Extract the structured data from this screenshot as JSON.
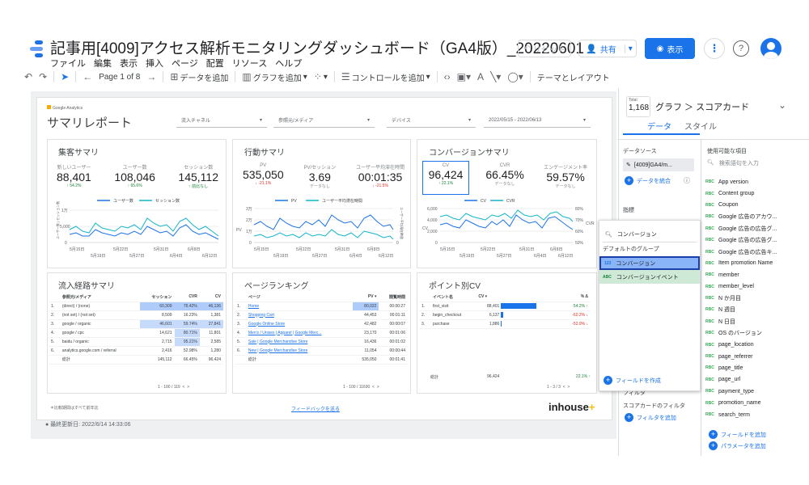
{
  "app": {
    "title": "記事用[4009]アクセス解析モニタリングダッシュボード（GA4版）_20220601",
    "menu": [
      "ファイル",
      "編集",
      "表示",
      "挿入",
      "ページ",
      "配置",
      "リソース",
      "ヘルプ"
    ],
    "reset_label": "リセット",
    "share_label": "共有",
    "view_label": "表示"
  },
  "toolbar": {
    "page_label": "Page 1 of 8",
    "add_data": "データを追加",
    "add_chart": "グラフを追加",
    "add_control": "コントロールを追加",
    "theme_layout": "テーマとレイアウト"
  },
  "report": {
    "ga_label": "Google Analytics",
    "title": "サマリレポート",
    "filters": [
      "流入チャネル",
      "参照元/メディア",
      "デバイス"
    ],
    "date_range": "2022/05/15 - 2022/06/13",
    "footnote": "＊比較期間はすべて前年比",
    "feedback": "フィードバックを送る",
    "brand_a": "inhouse",
    "brand_b": "+",
    "last_updated": "最終更新日: 2022/6/14 14:33:06"
  },
  "acquisition": {
    "title": "集客サマリ",
    "kpis": [
      {
        "label": "新しいユーザー",
        "value": "88,401",
        "delta": "↑ 54.2%"
      },
      {
        "label": "ユーザー数",
        "value": "108,046",
        "delta": "↑ 65.6%"
      },
      {
        "label": "セッション数",
        "value": "145,112",
        "delta": "↑ 前比なし"
      }
    ],
    "legend": [
      "ユーザー数",
      "セッション数"
    ],
    "yticks": [
      "15,000",
      "10,000",
      "5,000",
      "0"
    ],
    "xticks_top": [
      "5月15日",
      "5月22日",
      "5月31日",
      "6月8日"
    ],
    "xticks_bot": [
      "5月19日",
      "5月27日",
      "6月4日",
      "6月12日"
    ],
    "axis_label": "ユーザー数 | セッション数"
  },
  "behavior": {
    "title": "行動サマリ",
    "kpis": [
      {
        "label": "PV",
        "value": "535,050",
        "delta": "↓ -21.1%"
      },
      {
        "label": "PV/セッション",
        "value": "3.69",
        "delta": "データなし"
      },
      {
        "label": "ユーザー平均滞在時間",
        "value": "00:01:35",
        "delta": "↓ -21.5%"
      }
    ],
    "legend": [
      "PV",
      "ユーザー平均滞在時間"
    ],
    "yticks_left": [
      "30,000",
      "20,000",
      "10,000",
      "0"
    ],
    "yticks_right": [
      "200",
      "150",
      "100",
      "50",
      "0"
    ],
    "y_right_label": "ユーザー平均滞在時間",
    "y_left_label": "PV"
  },
  "conversion": {
    "title": "コンバージョンサマリ",
    "kpis": [
      {
        "label": "CV",
        "value": "96,424",
        "delta": "↑ 22.1%"
      },
      {
        "label": "CVR",
        "value": "66.45%",
        "delta": "データなし"
      },
      {
        "label": "エンゲージメント率",
        "value": "59.57%",
        "delta": "データなし"
      }
    ],
    "legend": [
      "CV",
      "CVR"
    ],
    "yticks_left": [
      "6,000",
      "4,000",
      "2,000",
      "0"
    ],
    "yticks_right": [
      "80%",
      "70%",
      "60%",
      "50%"
    ],
    "y_left_label": "CV",
    "y_right_label": "CVR"
  },
  "traffic": {
    "title": "流入経路サマリ",
    "headers": [
      "参照元/メディア",
      "セッション",
      "CVR",
      "CV"
    ],
    "rows": [
      [
        "1.",
        "(direct) / (none)",
        "60,309",
        "76.42%",
        "46,136"
      ],
      [
        "2.",
        "(not set) / (not set)",
        "8,509",
        "16.23%",
        "1,381"
      ],
      [
        "3.",
        "google / organic",
        "46,601",
        "59.74%",
        "27,841"
      ],
      [
        "4.",
        "google / cpc",
        "14,621",
        "80.71%",
        "11,801"
      ],
      [
        "5.",
        "baidu / organic",
        "2,715",
        "95.21%",
        "2,585"
      ],
      [
        "6.",
        "analytics.google.com / referral",
        "2,416",
        "52.98%",
        "1,280"
      ]
    ],
    "total": [
      "総計",
      "145,112",
      "66.45%",
      "96,424"
    ],
    "pager": "1 - 100 / 119"
  },
  "pages": {
    "title": "ページランキング",
    "headers": [
      "ページ",
      "PV ▾",
      "閲覧時間"
    ],
    "rows": [
      [
        "1.",
        "Home",
        "80,022",
        "00:00:27"
      ],
      [
        "2.",
        "Shopping Cart",
        "44,453",
        "00:01:11"
      ],
      [
        "3.",
        "Google Online Store",
        "42,482",
        "00:00:07"
      ],
      [
        "4.",
        "Men's / Unisex | Apparel | Google Merc...",
        "23,170",
        "00:01:06"
      ],
      [
        "5.",
        "Sale | Google Merchandise Store",
        "16,436",
        "00:01:02"
      ],
      [
        "6.",
        "New | Google Merchandise Store",
        "11,054",
        "00:00:44"
      ]
    ],
    "total": [
      "総計",
      "535,050",
      "00:01:41"
    ],
    "pager": "1 - 100 / 11690"
  },
  "events": {
    "title": "ポイント別CV",
    "headers": [
      "イベント名",
      "CV ▾",
      "% Δ"
    ],
    "rows": [
      {
        "n": "1.",
        "name": "first_visit",
        "cv": "88,401",
        "bar": 1.0,
        "d": "54.2% ↑",
        "up": true
      },
      {
        "n": "2.",
        "name": "begin_checkout",
        "cv": "6,137",
        "bar": 0.07,
        "d": "-60.2% ↓",
        "up": false
      },
      {
        "n": "3.",
        "name": "purchase",
        "cv": "1,886",
        "bar": 0.021,
        "d": "-52.9% ↓",
        "up": false
      }
    ],
    "total": [
      "総計",
      "96,424",
      "22.1% ↑"
    ],
    "pager": "1 - 3 / 3"
  },
  "sidebar": {
    "total_label": "Total",
    "total_value": "1,168",
    "breadcrumb": "グラフ ＞ スコアカード",
    "tabs": [
      "データ",
      "スタイル"
    ],
    "datasource_label": "データソース",
    "datasource": "[4009]GA4/m...",
    "blend_label": "データを統合",
    "metric_label": "指標",
    "filter_label": "フィルタ",
    "score_filter_label": "スコアカードのフィルタ",
    "add_filter": "フィルタを追加",
    "available_label": "使用可能な項目",
    "field_search": "検索語句を入力",
    "fields": [
      "App version",
      "Content group",
      "Coupon",
      "Google 広告のアカウ...",
      "Google 広告の広告グ...",
      "Google 広告の広告グ...",
      "Google 広告の広告キ...",
      "Item promotion Name",
      "member",
      "member_level",
      "N か月目",
      "N 週目",
      "N 日目",
      "OS のバージョン",
      "page_location",
      "page_referrer",
      "page_title",
      "page_url",
      "payment_type",
      "promotion_name",
      "search_term"
    ],
    "add_field": "フィールドを追加",
    "add_param": "パラメータを追加"
  },
  "dropdown": {
    "search_value": "コンバージョン",
    "group_label": "デフォルトのグループ",
    "options": [
      {
        "badge": "123",
        "label": "コンバージョン"
      },
      {
        "badge": "ABC",
        "label": "コンバージョンイベント"
      }
    ],
    "create_field": "フィールドを作成"
  }
}
